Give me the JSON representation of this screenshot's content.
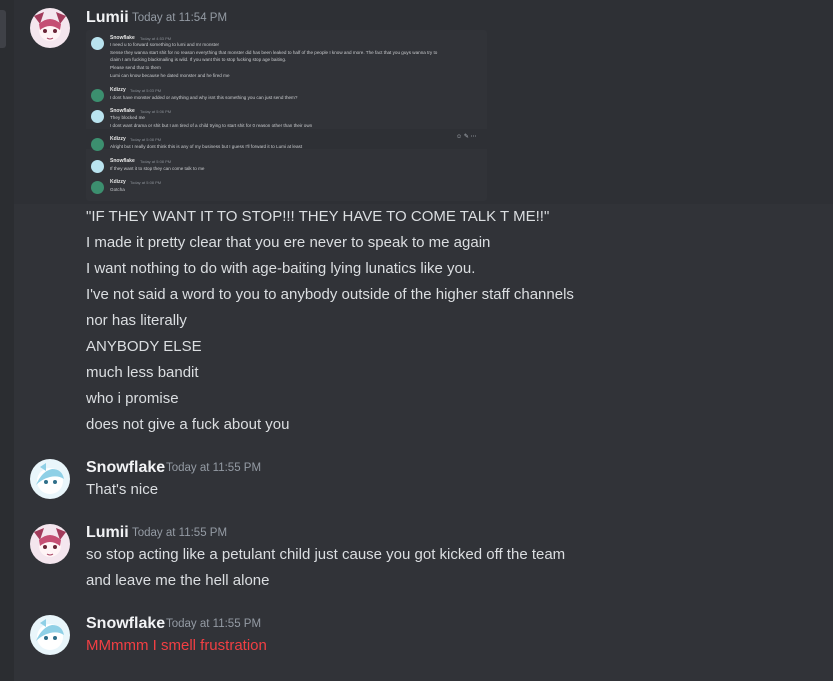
{
  "messages": [
    {
      "author": "Lumii",
      "timestamp": "Today at 11:54 PM",
      "attachment": {
        "messages": [
          {
            "author": "Snowflake",
            "timestamp": "Today at 4:53 PM",
            "lines": [
              "I need u to forward something to lumi and mr monster",
              "Sense they wanna start shit for no reason everything that monster did has been leaked to half of the people I know and more. The fact that you guys wanna try to",
              "claim I am fucking blackmailing is wild. If you want this to stop fucking stop age baiting.",
              "Please send that to them",
              "Lumi can know because he dated monster and he fired me"
            ]
          },
          {
            "author": "Kdizzy",
            "timestamp": "Today at 5:03 PM",
            "lines": [
              "I dont have monster added or anything and why isnt this something you can just send them?"
            ]
          },
          {
            "author": "Snowflake",
            "timestamp": "Today at 5:06 PM",
            "lines": [
              "They blocked me",
              "I dont want drama or shit but I am tired of a child trying to start shit for 0 reason other than their own"
            ]
          },
          {
            "author": "Kdizzy",
            "timestamp": "Today at 5:08 PM",
            "lines": [
              "Alright but I really dont think this is any of my business but I guess I'll forward it to Lumi at least"
            ]
          },
          {
            "author": "Snowflake",
            "timestamp": "Today at 5:08 PM",
            "lines": [
              "If they want it to stop they can come talk to me"
            ]
          },
          {
            "author": "Kdizzy",
            "timestamp": "Today at 5:08 PM",
            "lines": [
              "Gotcha"
            ]
          }
        ]
      },
      "lines": [
        "\"IF THEY WANT IT TO STOP!!! THEY HAVE TO COME TALK T ME!!\"",
        "I made it pretty clear that you ere never to speak to me again",
        "I want nothing to do with age-baiting lying lunatics like you.",
        "I've not said a word to you to anybody outside of the higher staff channels",
        "nor has literally",
        "ANYBODY ELSE",
        "much less bandit",
        "who i promise",
        "does not give a fuck about you"
      ]
    },
    {
      "author": "Snowflake",
      "timestamp": "Today at 11:55 PM",
      "lines": [
        "That's nice"
      ]
    },
    {
      "author": "Lumii",
      "timestamp": "Today at 11:55 PM",
      "lines": [
        "so stop acting like a petulant child just cause you got kicked off the team",
        "and leave me the hell alone"
      ]
    },
    {
      "author": "Snowflake",
      "timestamp": "Today at 11:55 PM",
      "lines": [
        "MMmmm I smell frustration"
      ]
    }
  ],
  "colors": {
    "background": "#313338",
    "author": "#f2f3f5",
    "timestamp": "#949ba4",
    "text": "#dbdee1",
    "highlight_text": "#f23f43"
  },
  "icons": [
    "avatar-lumii",
    "avatar-snowflake",
    "avatar-kdizzy",
    "add-reaction-icon",
    "edit-icon",
    "more-icon"
  ]
}
